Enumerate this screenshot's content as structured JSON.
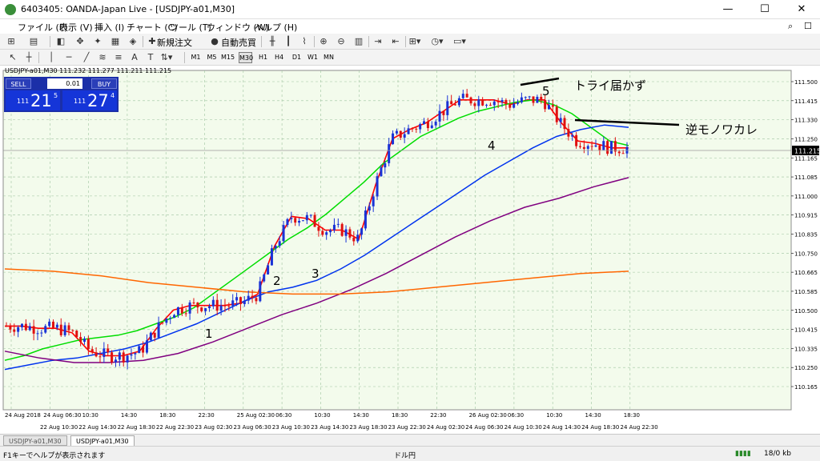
{
  "window": {
    "title": "6403405: OANDA-Japan Live - [USDJPY-a01,M30]",
    "controls": {
      "minimize": "—",
      "maximize": "☐",
      "close": "✕"
    }
  },
  "menu": {
    "items": [
      "ファイル (F)",
      "表示 (V)",
      "挿入 (I)",
      "チャート (C)",
      "ツール (T)",
      "ウィンドウ (W)",
      "ヘルプ (H)"
    ]
  },
  "toolbar": {
    "new_order_label": "新規注文",
    "auto_trade_label": "自動売買",
    "text_tool_label": "A",
    "text_label_tool_label": "T",
    "timeframes": [
      "M1",
      "M5",
      "M15",
      "M30",
      "H1",
      "H4",
      "D1",
      "W1",
      "MN"
    ],
    "active_timeframe": "M30"
  },
  "chart": {
    "info_line": "USDJPY-a01,M30  111.232 111.277 111.211 111.215",
    "current_price": "111.215",
    "sell_label": "SELL",
    "buy_label": "BUY",
    "lot_value": "0.01",
    "bid": {
      "small": "111",
      "big": "21",
      "sup": "5"
    },
    "ask": {
      "small": "111",
      "big": "27",
      "sup": "4"
    },
    "annotations": [
      "1",
      "2",
      "3",
      "4",
      "5",
      "トライ届かず",
      "逆モノワカレ"
    ]
  },
  "chart_data": {
    "type": "line",
    "title": "USDJPY-a01,M30",
    "y_ticks": [
      "111.500",
      "111.415",
      "111.330",
      "111.250",
      "111.165",
      "111.085",
      "111.000",
      "110.915",
      "110.835",
      "110.750",
      "110.665",
      "110.585",
      "110.500",
      "110.415",
      "110.335",
      "110.250",
      "110.165"
    ],
    "ylim": [
      110.165,
      111.5
    ],
    "x_ticks": [
      "24 Aug 2018",
      "24 Aug 06:30",
      "10:30",
      "14:30",
      "18:30",
      "22:30",
      "25 Aug 02:30",
      "06:30",
      "10:30",
      "14:30",
      "18:30",
      "22:30",
      "26 Aug 02:30",
      "06:30",
      "10:30",
      "14:30",
      "18:30"
    ],
    "x_ticks_secondary": [
      "22 Aug 10:30",
      "22 Aug 14:30",
      "22 Aug 18:30",
      "22 Aug 22:30",
      "23 Aug 02:30",
      "23 Aug 06:30",
      "23 Aug 10:30",
      "23 Aug 14:30",
      "23 Aug 18:30",
      "23 Aug 22:30",
      "24 Aug 02:30",
      "24 Aug 06:30",
      "24 Aug 10:30",
      "24 Aug 14:30",
      "24 Aug 18:30",
      "24 Aug 22:30"
    ],
    "grid": true,
    "series": [
      {
        "color": "#ff0000",
        "values": [
          110.43,
          110.43,
          110.42,
          110.42,
          110.4,
          110.32,
          110.3,
          110.3,
          110.32,
          110.42,
          110.5,
          110.52,
          110.52,
          110.52,
          110.53,
          110.57,
          110.78,
          110.91,
          110.9,
          110.85,
          110.85,
          110.81,
          111.05,
          111.25,
          111.29,
          111.32,
          111.37,
          111.42,
          111.42,
          111.42,
          111.4,
          111.42,
          111.42,
          111.32,
          111.24,
          111.23,
          111.21,
          111.21
        ]
      },
      {
        "color": "#00dd00",
        "values": [
          110.28,
          110.3,
          110.33,
          110.35,
          110.37,
          110.38,
          110.39,
          110.41,
          110.44,
          110.47,
          110.51,
          110.57,
          110.63,
          110.69,
          110.75,
          110.81,
          110.86,
          110.92,
          110.99,
          111.06,
          111.14,
          111.2,
          111.26,
          111.3,
          111.34,
          111.37,
          111.39,
          111.41,
          111.42,
          111.4,
          111.36,
          111.3,
          111.24,
          111.22
        ]
      },
      {
        "color": "#0033ee",
        "values": [
          110.24,
          110.26,
          110.28,
          110.29,
          110.31,
          110.33,
          110.36,
          110.4,
          110.44,
          110.49,
          110.54,
          110.58,
          110.6,
          110.63,
          110.68,
          110.74,
          110.81,
          110.88,
          110.95,
          111.02,
          111.09,
          111.15,
          111.21,
          111.26,
          111.29,
          111.31,
          111.3
        ]
      },
      {
        "color": "#800080",
        "values": [
          110.32,
          110.29,
          110.27,
          110.27,
          110.28,
          110.31,
          110.36,
          110.42,
          110.48,
          110.53,
          110.59,
          110.66,
          110.74,
          110.82,
          110.89,
          110.95,
          110.99,
          111.04,
          111.08
        ]
      },
      {
        "color": "#ff6600",
        "values": [
          110.68,
          110.67,
          110.65,
          110.62,
          110.6,
          110.58,
          110.57,
          110.57,
          110.58,
          110.6,
          110.62,
          110.64,
          110.66,
          110.67
        ]
      }
    ]
  },
  "tabs": [
    "USDJPY-a01,M30",
    "USDJPY-a01,M30"
  ],
  "status": {
    "help_text": "F1キーでヘルプが表示されます",
    "symbol_text": "ドル円",
    "traffic_text": "18/0 kb"
  }
}
